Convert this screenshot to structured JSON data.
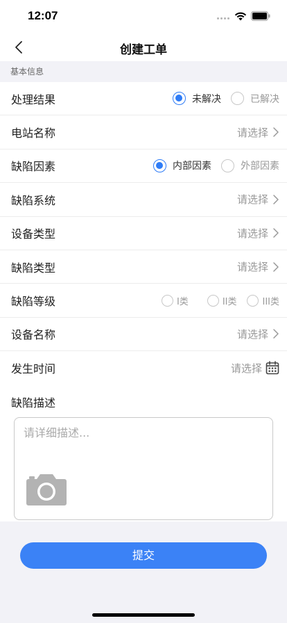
{
  "status_bar": {
    "time": "12:07"
  },
  "nav": {
    "title": "创建工单"
  },
  "section": {
    "title": "基本信息"
  },
  "form": {
    "result": {
      "label": "处理结果",
      "options": [
        {
          "label": "未解决",
          "checked": true
        },
        {
          "label": "已解决",
          "checked": false
        }
      ]
    },
    "station": {
      "label": "电站名称",
      "value": "请选择"
    },
    "factor": {
      "label": "缺陷因素",
      "options": [
        {
          "label": "内部因素",
          "checked": true
        },
        {
          "label": "外部因素",
          "checked": false
        }
      ]
    },
    "system": {
      "label": "缺陷系统",
      "value": "请选择"
    },
    "device_type": {
      "label": "设备类型",
      "value": "请选择"
    },
    "defect_type": {
      "label": "缺陷类型",
      "value": "请选择"
    },
    "level": {
      "label": "缺陷等级",
      "options": [
        {
          "label": "I类",
          "checked": false
        },
        {
          "label": "II类",
          "checked": false
        },
        {
          "label": "III类",
          "checked": false
        }
      ]
    },
    "device_name": {
      "label": "设备名称",
      "value": "请选择"
    },
    "time": {
      "label": "发生时间",
      "value": "请选择"
    },
    "description": {
      "label": "缺陷描述",
      "placeholder": "请详细描述..."
    }
  },
  "submit": {
    "label": "提交"
  },
  "colors": {
    "accent": "#2f7cf6",
    "button": "#3b82f6",
    "background": "#f2f2f7"
  },
  "icons": [
    "back-icon",
    "chevron-right-icon",
    "calendar-icon",
    "camera-icon",
    "wifi-icon",
    "battery-icon"
  ]
}
